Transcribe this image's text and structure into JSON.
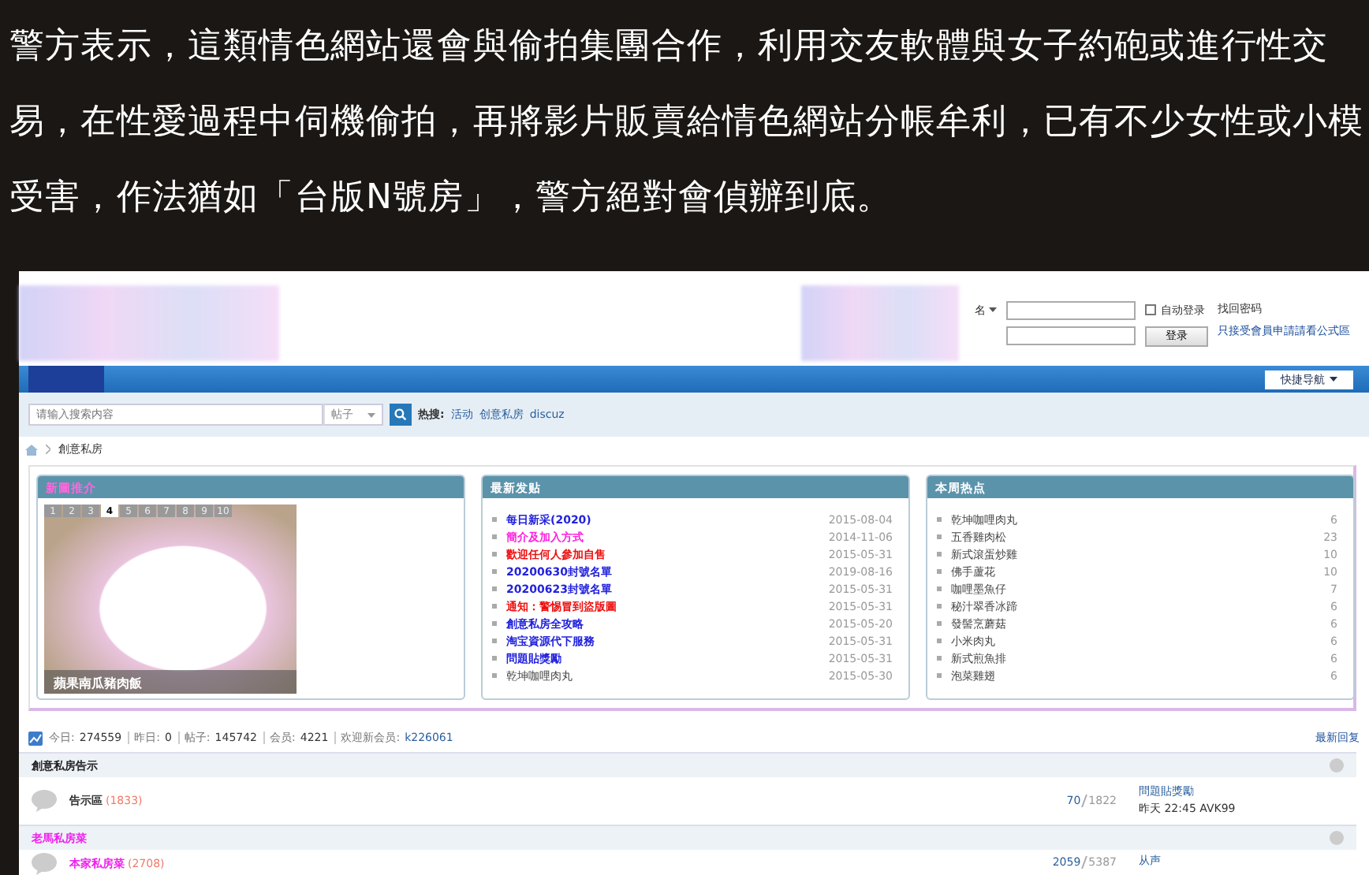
{
  "caption": {
    "lines": [
      "警方表示，這類情色網站還會與偷拍集團合作，利用交友軟體與女子約砲或進行性交",
      "易，在性愛過程中伺機偷拍，再將影片販賣給情色網站分帳牟利，已有不少女性或小模",
      "受害，作法猶如「台版N號房」，警方絕對會偵辦到底。"
    ]
  },
  "login": {
    "username_label": "名",
    "remember_label": "自动登录",
    "remember_checked": false,
    "forgot": "找回密码",
    "button": "登录",
    "notice": "只接受會員申請請看公式區"
  },
  "nav": {
    "quick_nav": "快捷导航"
  },
  "search": {
    "placeholder": "请输入搜索内容",
    "scope": "帖子",
    "hot_label": "热搜:",
    "hot": [
      "活动",
      "创意私房",
      "discuz"
    ]
  },
  "breadcrumb": "創意私房",
  "panels": {
    "featured": {
      "title": "新圖推介",
      "slides": [
        {
          "label": "1",
          "selected": false
        },
        {
          "label": "2",
          "selected": false
        },
        {
          "label": "3",
          "selected": false
        },
        {
          "label": "4",
          "selected": true
        },
        {
          "label": "5",
          "selected": false
        },
        {
          "label": "6",
          "selected": false
        },
        {
          "label": "7",
          "selected": false
        },
        {
          "label": "8",
          "selected": false
        },
        {
          "label": "9",
          "selected": false
        },
        {
          "label": "10",
          "selected": false
        }
      ],
      "caption": "蘋果南瓜豬肉飯"
    },
    "latest": {
      "title": "最新发贴",
      "items": [
        {
          "title": "每日新采(2020)",
          "date": "2015-08-04",
          "color": "#2222dd",
          "bold": true
        },
        {
          "title": "簡介及加入方式",
          "date": "2014-11-06",
          "color": "#ff22dd",
          "bold": true
        },
        {
          "title": "歡迎任何人參加自售",
          "date": "2015-05-31",
          "color": "#ee1111",
          "bold": true
        },
        {
          "title": "20200630封號名單",
          "date": "2019-08-16",
          "color": "#2222dd",
          "bold": true
        },
        {
          "title": "20200623封號名單",
          "date": "2015-05-31",
          "color": "#2222dd",
          "bold": true
        },
        {
          "title": "通知：警惕冒到盜版圖",
          "date": "2015-05-31",
          "color": "#ee1111",
          "bold": true
        },
        {
          "title": "創意私房全攻略",
          "date": "2015-05-20",
          "color": "#2222dd",
          "bold": true
        },
        {
          "title": "淘宝資源代下服務",
          "date": "2015-05-31",
          "color": "#2222dd",
          "bold": true
        },
        {
          "title": "問題貼獎勵",
          "date": "2015-05-31",
          "color": "#2222dd",
          "bold": true
        },
        {
          "title": "乾坤咖哩肉丸",
          "date": "2015-05-30",
          "color": "#444444",
          "bold": false
        }
      ]
    },
    "hot": {
      "title": "本周热点",
      "items": [
        {
          "title": "乾坤咖哩肉丸",
          "count": "6"
        },
        {
          "title": "五香雞肉松",
          "count": "23"
        },
        {
          "title": "新式滾蛋炒雞",
          "count": "10"
        },
        {
          "title": "佛手蘆花",
          "count": "10"
        },
        {
          "title": "咖哩墨魚仔",
          "count": "7"
        },
        {
          "title": "秘汁翠香冰蹄",
          "count": "6"
        },
        {
          "title": "發髻烹蘑菇",
          "count": "6"
        },
        {
          "title": "小米肉丸",
          "count": "6"
        },
        {
          "title": "新式煎魚排",
          "count": "6"
        },
        {
          "title": "泡菜雞翅",
          "count": "6"
        }
      ]
    }
  },
  "stats": {
    "items": [
      {
        "label": "今日:",
        "value": "274559"
      },
      {
        "label": "昨日:",
        "value": "0"
      },
      {
        "label": "帖子:",
        "value": "145742"
      },
      {
        "label": "会员:",
        "value": "4221"
      },
      {
        "label": "欢迎新会员:",
        "value": "k226061"
      }
    ],
    "latest_reply": "最新回复"
  },
  "sections": [
    {
      "title": "創意私房告示",
      "color": "#222222",
      "forums": [
        {
          "name": "告示區",
          "count": "(1833)",
          "threads": "70",
          "posts": "1822",
          "last_title": "問題貼獎勵",
          "last_meta": "昨天 22:45 AVK99"
        }
      ]
    },
    {
      "title": "老馬私房菜",
      "color": "#ee22ee",
      "forums": [
        {
          "name": "本家私房菜",
          "count": "(2708)",
          "threads": "2059",
          "posts": "5387",
          "last_title": "从声"
        }
      ]
    }
  ]
}
